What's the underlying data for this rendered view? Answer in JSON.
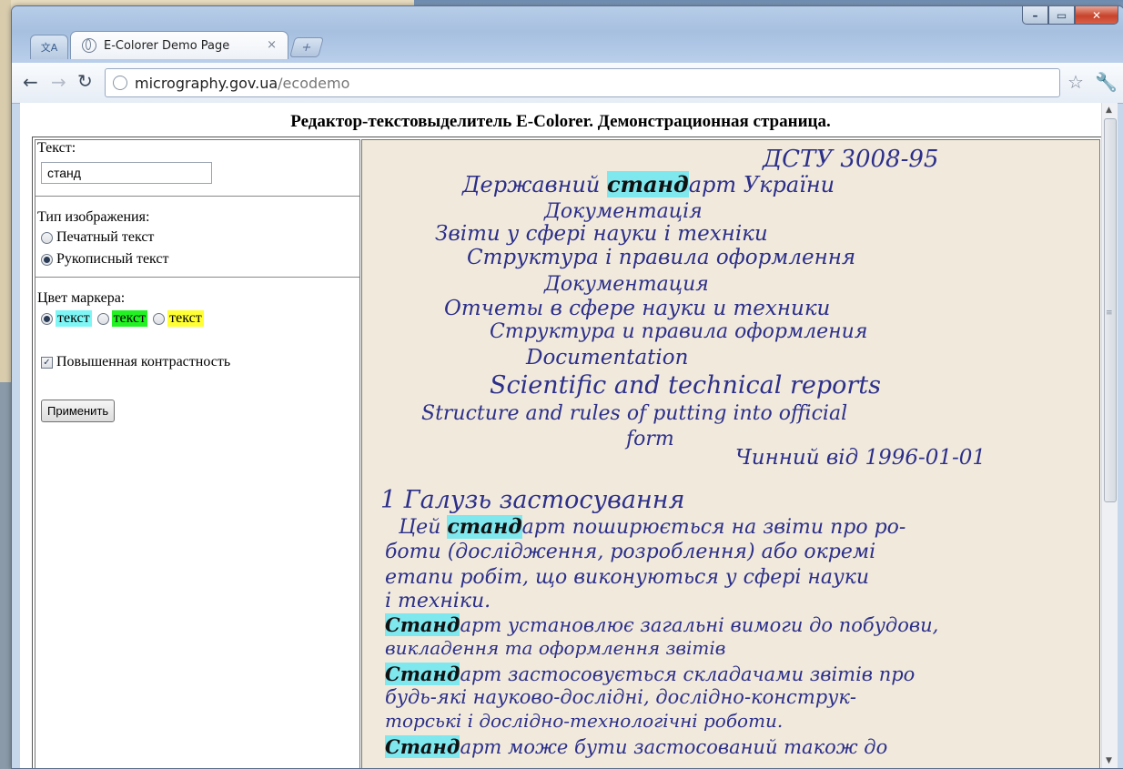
{
  "browser": {
    "tab_title": "E-Colorer Demo Page",
    "tab_close": "×",
    "new_tab": "+",
    "url_host": "micrography.gov.ua",
    "url_path": "/ecodemo"
  },
  "page": {
    "title": "Редактор-текстовыделитель E-Colorer. Демонстрационная страница."
  },
  "form": {
    "text_label": "Текст:",
    "text_value": "станд",
    "image_type_label": "Тип изображения:",
    "image_type_options": [
      "Печатный текст",
      "Рукописный текст"
    ],
    "image_type_selected": "Рукописный текст",
    "marker_label": "Цвет маркера:",
    "marker_options": [
      {
        "label": "текст",
        "color": "#7ff6f6"
      },
      {
        "label": "текст",
        "color": "#22f222"
      },
      {
        "label": "текст",
        "color": "#ffff33"
      }
    ],
    "marker_selected": 0,
    "contrast_label": "Повышенная контрастность",
    "contrast_checked": true,
    "apply_label": "Применить"
  },
  "document": {
    "highlight_color": "#7fe7ee",
    "lines": [
      "ДСТУ 3008-95",
      "Державний стандарт України",
      "Документація",
      "Звіти у сфері науки і техніки",
      "Структура і правила оформлення",
      "Документация",
      "Отчеты в сфере науки и техники",
      "Структура и правила оформления",
      "Documentation",
      "Scientific and technical reports",
      "Structure and rules of putting into official",
      "form",
      "Чинний від 1996-01-01",
      "1 Галузь застосування",
      "Цей стандарт поширюється на звіти про ро-",
      "боти (дослідження, розроблення) або окремі",
      "етапи робіт, що виконуються у сфері науки",
      "і техніки.",
      "Стандарт установлює загальні вимоги до побудови,",
      "викладення та оформлення звітів",
      "Стандарт застосовується складачами звітів про",
      "будь-які науково-дослідні, дослідно-конструк-",
      "торські і дослідно-технологічні роботи.",
      "Стандарт може бути застосований також до"
    ]
  }
}
